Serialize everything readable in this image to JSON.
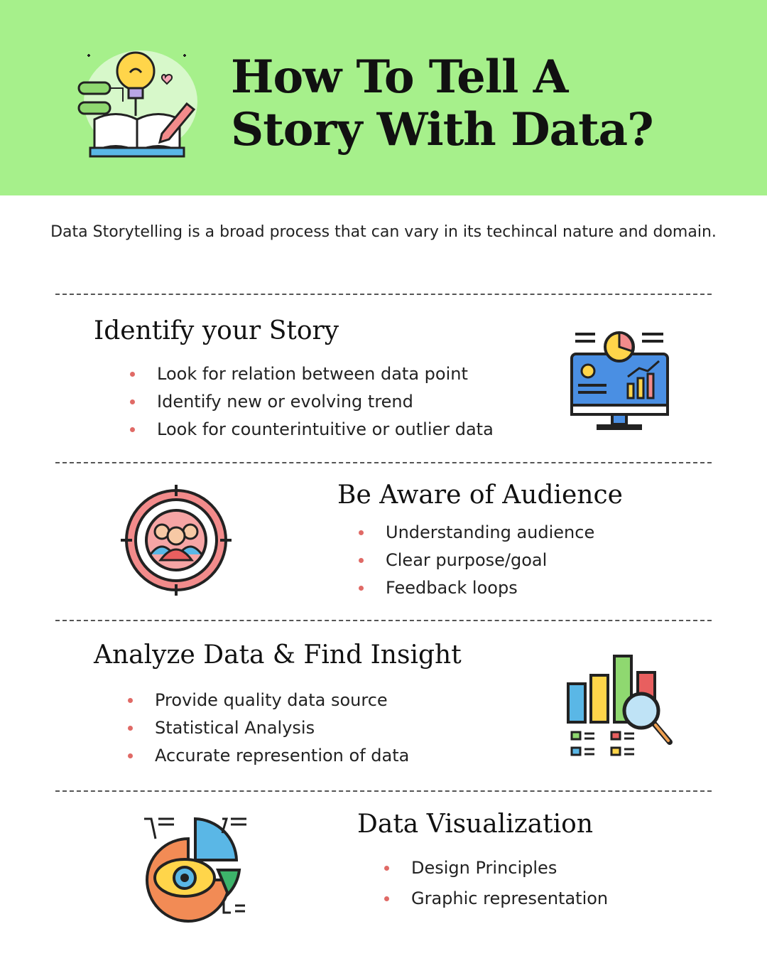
{
  "header": {
    "title_line1": "How To Tell A",
    "title_line2": "Story With Data?",
    "icon": "lightbulb-book-pencil-icon"
  },
  "intro": {
    "text": "Data Storytelling is a broad process that can vary in its techincal nature and domain."
  },
  "sections": [
    {
      "title": "Identify your Story",
      "icon": "monitor-dashboard-icon",
      "items": [
        "Look for relation between data point",
        "Identify new or evolving trend",
        "Look for counterintuitive or outlier data"
      ]
    },
    {
      "title": "Be Aware of Audience",
      "icon": "audience-target-icon",
      "items": [
        "Understanding audience",
        "Clear purpose/goal",
        "Feedback loops"
      ]
    },
    {
      "title": "Analyze Data & Find Insight",
      "icon": "bar-chart-magnifier-icon",
      "items": [
        "Provide quality data source",
        "Statistical Analysis",
        "Accurate represention of data"
      ]
    },
    {
      "title": "Data Visualization",
      "icon": "pie-chart-eye-icon",
      "items": [
        "Design Principles",
        "Graphic representation"
      ]
    }
  ],
  "colors": {
    "header_bg": "#a6f08b",
    "bullet": "#e06a66",
    "divider": "#555555"
  }
}
